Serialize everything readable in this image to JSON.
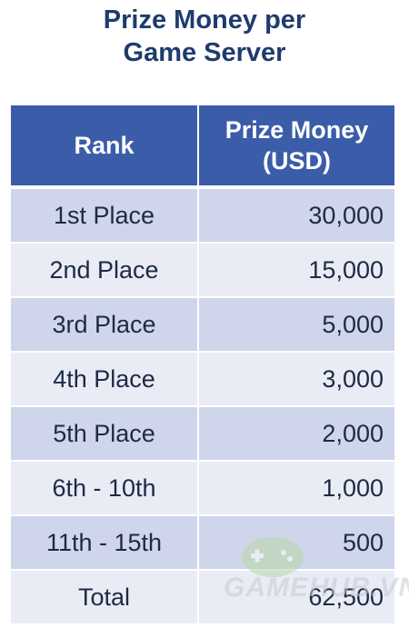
{
  "title": {
    "line1": "Prize Money per",
    "line2": "Game Server"
  },
  "table": {
    "headers": {
      "rank": "Rank",
      "money_line1": "Prize Money",
      "money_line2": "(USD)"
    },
    "rows": [
      {
        "rank": "1st Place",
        "money": "30,000"
      },
      {
        "rank": "2nd Place",
        "money": "15,000"
      },
      {
        "rank": "3rd Place",
        "money": "5,000"
      },
      {
        "rank": "4th Place",
        "money": "3,000"
      },
      {
        "rank": "5th Place",
        "money": "2,000"
      },
      {
        "rank": "6th - 10th",
        "money": "1,000"
      },
      {
        "rank": "11th - 15th",
        "money": "500"
      },
      {
        "rank": "Total",
        "money": "62,500"
      }
    ]
  },
  "watermark": {
    "text": "GAMEHUB.VN",
    "icon": "gamepad-icon"
  },
  "colors": {
    "title": "#1f3b6e",
    "header_bg": "#3b5ca8",
    "row_dark": "#cfd5ea",
    "row_light": "#e9ecf5"
  }
}
